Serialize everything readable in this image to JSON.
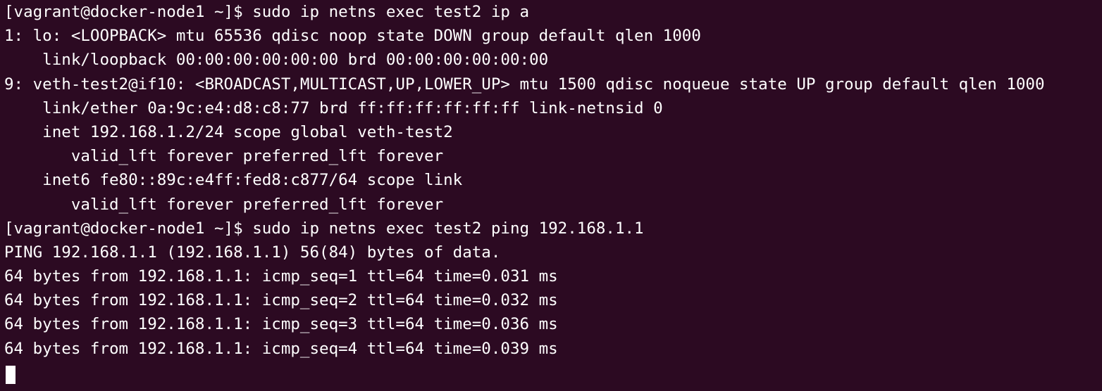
{
  "terminal": {
    "lines": [
      "[vagrant@docker-node1 ~]$ sudo ip netns exec test2 ip a",
      "1: lo: <LOOPBACK> mtu 65536 qdisc noop state DOWN group default qlen 1000",
      "    link/loopback 00:00:00:00:00:00 brd 00:00:00:00:00:00",
      "9: veth-test2@if10: <BROADCAST,MULTICAST,UP,LOWER_UP> mtu 1500 qdisc noqueue state UP group default qlen 1000",
      "    link/ether 0a:9c:e4:d8:c8:77 brd ff:ff:ff:ff:ff:ff link-netnsid 0",
      "    inet 192.168.1.2/24 scope global veth-test2",
      "       valid_lft forever preferred_lft forever",
      "    inet6 fe80::89c:e4ff:fed8:c877/64 scope link",
      "       valid_lft forever preferred_lft forever",
      "[vagrant@docker-node1 ~]$ sudo ip netns exec test2 ping 192.168.1.1",
      "PING 192.168.1.1 (192.168.1.1) 56(84) bytes of data.",
      "64 bytes from 192.168.1.1: icmp_seq=1 ttl=64 time=0.031 ms",
      "64 bytes from 192.168.1.1: icmp_seq=2 ttl=64 time=0.032 ms",
      "64 bytes from 192.168.1.1: icmp_seq=3 ttl=64 time=0.036 ms",
      "64 bytes from 192.168.1.1: icmp_seq=4 ttl=64 time=0.039 ms"
    ]
  },
  "colors": {
    "background": "#2c0a22",
    "text": "#ffffff",
    "cursor": "#ffffff"
  }
}
